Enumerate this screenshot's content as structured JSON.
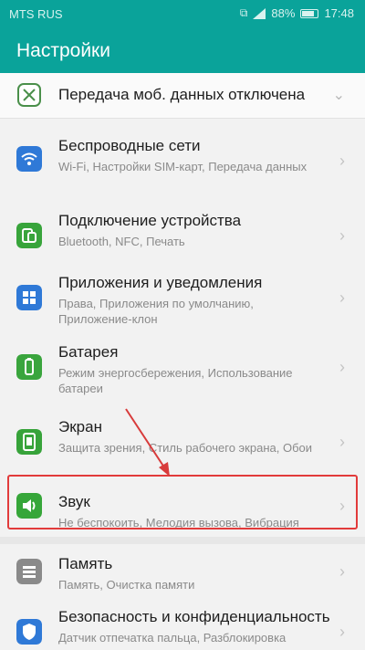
{
  "status_bar": {
    "carrier": "MTS RUS",
    "battery": "88%",
    "time": "17:48"
  },
  "app_bar": {
    "title": "Настройки"
  },
  "top_row": {
    "label": "Передача моб. данных отключена",
    "icon": "mobile-data-icon",
    "color": "#4a8f4a"
  },
  "items": [
    {
      "title": "Беспроводные сети",
      "subtitle": "Wi-Fi, Настройки SIM-карт, Передача данных",
      "icon": "wifi-icon",
      "color": "#2f79d7"
    },
    {
      "title": "Подключение устройства",
      "subtitle": "Bluetooth, NFC, Печать",
      "icon": "device-connection-icon",
      "color": "#38a43b"
    },
    {
      "title": "Приложения и уведомления",
      "subtitle": "Права, Приложения по умолчанию, Приложение-клон",
      "icon": "apps-icon",
      "color": "#2f79d7"
    },
    {
      "title": "Батарея",
      "subtitle": "Режим энергосбережения, Использование батареи",
      "icon": "battery-icon",
      "color": "#3aa53d"
    },
    {
      "title": "Экран",
      "subtitle": "Защита зрения, Стиль рабочего экрана, Обои",
      "icon": "display-icon",
      "color": "#37a33a"
    },
    {
      "title": "Звук",
      "subtitle": "Не беспокоить, Мелодия вызова, Вибрация",
      "icon": "sound-icon",
      "color": "#36a639"
    },
    {
      "title": "Память",
      "subtitle": "Память, Очистка памяти",
      "icon": "storage-icon",
      "color": "#8a8a8a"
    },
    {
      "title": "Безопасность и конфиденциальность",
      "subtitle": "Датчик отпечатка пальца, Разблокировка экрана и пароли",
      "icon": "security-icon",
      "color": "#2f79d7"
    }
  ],
  "highlight": {
    "color": "#e23b3b"
  }
}
